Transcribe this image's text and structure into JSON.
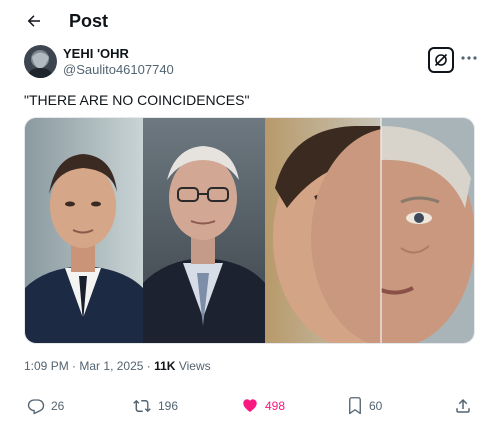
{
  "header": {
    "title": "Post"
  },
  "author": {
    "display_name": "YEHI 'OHR",
    "handle": "@Saulito46107740"
  },
  "post": {
    "text": "\"THERE ARE NO COINCIDENCES\"",
    "time": "1:09 PM",
    "date": "Mar 1, 2025",
    "separator": "·",
    "views_count": "11K",
    "views_label": "Views"
  },
  "actions": {
    "replies": "26",
    "reposts": "196",
    "likes": "498",
    "bookmarks": "60"
  },
  "colors": {
    "text": "#0f1419",
    "secondary": "#536471",
    "like": "#f91880"
  },
  "icons": {
    "back": "arrow-left-icon",
    "grok": "grok-icon",
    "more": "more-horizontal-icon",
    "reply": "reply-icon",
    "repost": "repost-icon",
    "like": "heart-icon",
    "bookmark": "bookmark-icon",
    "share": "share-icon"
  }
}
